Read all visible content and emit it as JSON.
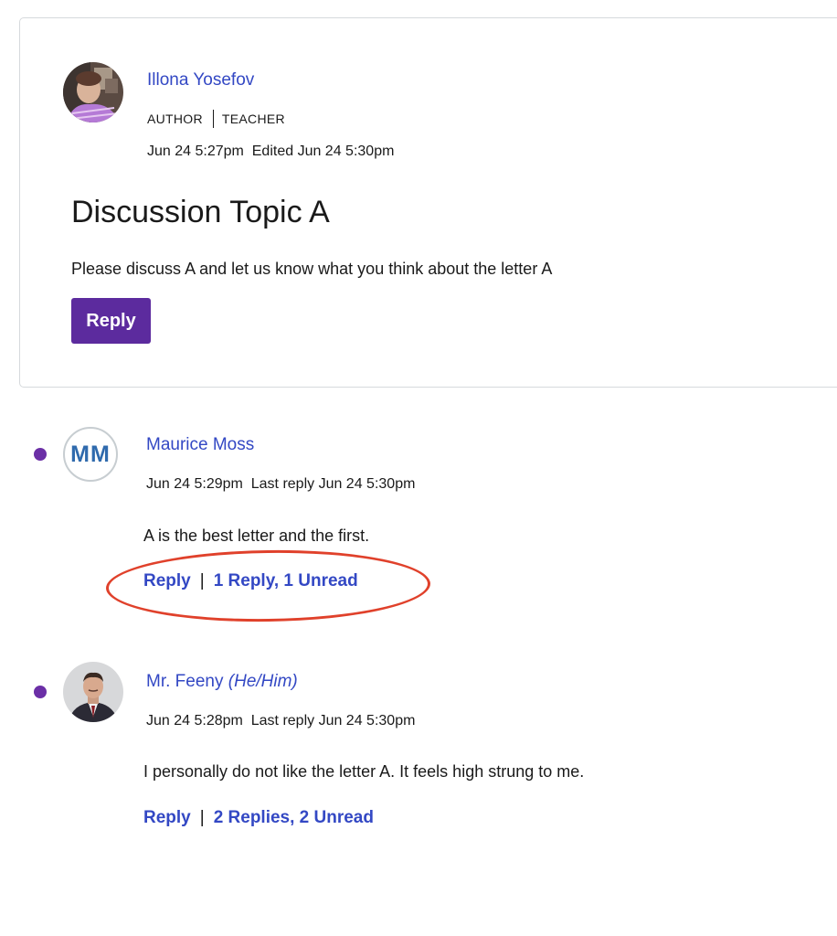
{
  "topic": {
    "author_name": "Illona Yosefov",
    "role_author": "AUTHOR",
    "role_teacher": "TEACHER",
    "posted": "Jun 24 5:27pm",
    "edited": "Edited Jun 24 5:30pm",
    "title": "Discussion Topic A",
    "body": "Please discuss A and let us know what you think about the letter A",
    "reply_label": "Reply"
  },
  "entries": [
    {
      "author_name": "Maurice Moss",
      "initials": "MM",
      "posted": "Jun 24 5:29pm",
      "last_reply": "Last reply Jun 24 5:30pm",
      "body": "A is the best letter and the first.",
      "reply_label": "Reply",
      "divider": "|",
      "replies_label": "1 Reply, 1 Unread",
      "unread": true
    },
    {
      "author_name": "Mr. Feeny",
      "pronouns": "(He/Him)",
      "posted": "Jun 24 5:28pm",
      "last_reply": "Last reply Jun 24 5:30pm",
      "body": "I personally do not like the letter A. It feels high strung to me.",
      "reply_label": "Reply",
      "divider": "|",
      "replies_label": "2 Replies, 2 Unread",
      "unread": true
    }
  ],
  "colors": {
    "link": "#3348c4",
    "primary_button": "#5c2b9e",
    "unread_dot": "#6b2fa6",
    "highlight": "#e0412b",
    "initials": "#2f6aad"
  },
  "icons": {
    "author_avatar": "user-photo-avatar",
    "entry_2_avatar": "user-photo-avatar",
    "unread": "unread-dot-icon"
  }
}
